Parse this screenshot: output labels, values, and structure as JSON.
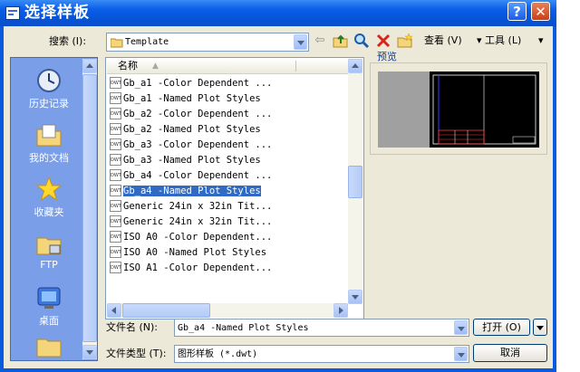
{
  "title": "选择样板",
  "window_buttons": {
    "help": "?",
    "close": "✕"
  },
  "toolbar": {
    "search_label": "搜索 (I):",
    "location": "Template",
    "view_label": "查看 (V)",
    "tools_label": "工具 (L)",
    "icons": [
      "back-icon",
      "up-folder-icon",
      "search-web-icon",
      "delete-icon",
      "new-folder-icon"
    ]
  },
  "preview_label": "预览",
  "places": [
    {
      "label": "历史记录",
      "icon": "history-icon"
    },
    {
      "label": "我的文档",
      "icon": "documents-icon"
    },
    {
      "label": "收藏夹",
      "icon": "favorites-icon"
    },
    {
      "label": "FTP",
      "icon": "ftp-icon"
    },
    {
      "label": "桌面",
      "icon": "desktop-icon"
    }
  ],
  "file_list": {
    "column_header": "名称",
    "selected_index": 7,
    "files": [
      "Gb_a1 -Color Dependent ...",
      "Gb_a1 -Named Plot Styles",
      "Gb_a2 -Color Dependent ...",
      "Gb_a2 -Named Plot Styles",
      "Gb_a3 -Color Dependent ...",
      "Gb_a3 -Named Plot Styles",
      "Gb_a4 -Color Dependent ...",
      "Gb_a4 -Named Plot Styles",
      "Generic 24in x 32in Tit...",
      "Generic 24in x 32in Tit...",
      "ISO A0 -Color Dependent...",
      "ISO A0 -Named Plot Styles",
      "ISO A1 -Color Dependent..."
    ],
    "file_badge": "DWT"
  },
  "filename_label": "文件名 (N):",
  "filename_value": "Gb_a4 -Named Plot Styles",
  "filetype_label": "文件类型 (T):",
  "filetype_value": "图形样板 (*.dwt)",
  "open_button": "打开 (O)",
  "cancel_button": "取消",
  "colors": {
    "titlebar": "#0a5fe8",
    "selection": "#316ac5",
    "places_bg": "#7a9ee8"
  }
}
